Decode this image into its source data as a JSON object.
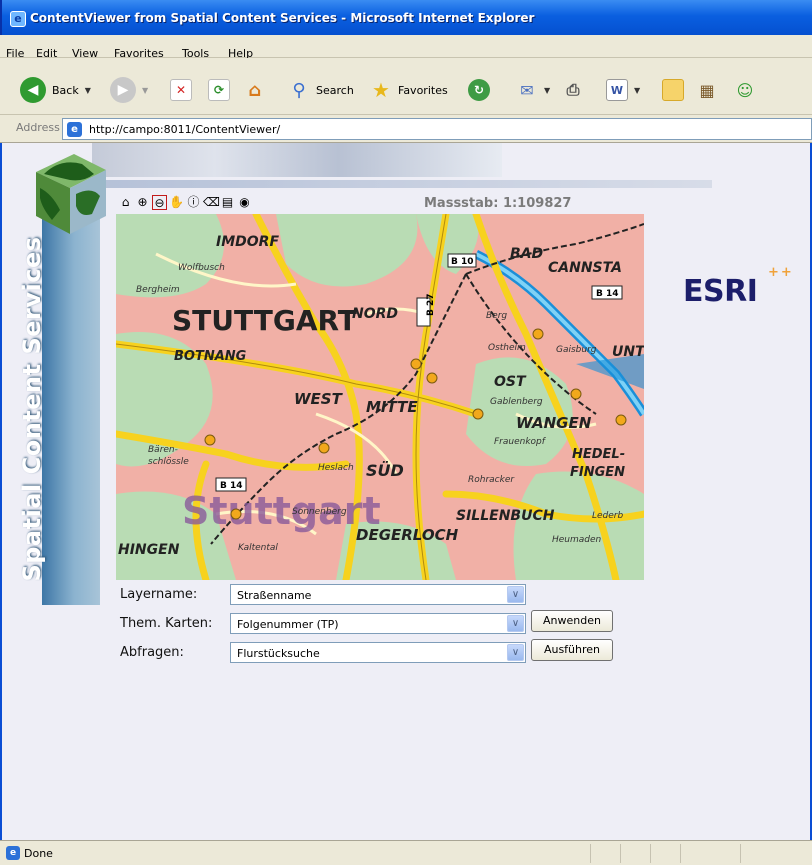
{
  "window": {
    "title": "ContentViewer from Spatial Content Services - Microsoft Internet Explorer"
  },
  "menu": [
    "File",
    "Edit",
    "View",
    "Favorites",
    "Tools",
    "Help"
  ],
  "toolbar": {
    "back_label": "Back",
    "search_label": "Search",
    "favorites_label": "Favorites"
  },
  "address": {
    "label": "Address",
    "url": "http://campo:8011/ContentViewer/"
  },
  "page": {
    "vertical_title": "Spatial Content Services",
    "scale_label": "Massstab: 1:109827",
    "logo": "ESRI",
    "logo_plus": "++"
  },
  "map": {
    "places": [
      {
        "name": "STUTTGART",
        "kind": "city"
      },
      {
        "name": "NORD",
        "kind": "district"
      },
      {
        "name": "WEST",
        "kind": "district"
      },
      {
        "name": "MITTE",
        "kind": "district"
      },
      {
        "name": "OST",
        "kind": "district"
      },
      {
        "name": "SÜD",
        "kind": "district"
      },
      {
        "name": "BOTNANG",
        "kind": "district"
      },
      {
        "name": "IMDORF",
        "kind": "district"
      },
      {
        "name": "WANGEN",
        "kind": "district"
      },
      {
        "name": "HEDEL-",
        "kind": "district"
      },
      {
        "name": "FINGEN",
        "kind": "district"
      },
      {
        "name": "DEGERLOCH",
        "kind": "district"
      },
      {
        "name": "SILLENBUCH",
        "kind": "district"
      },
      {
        "name": "BAD",
        "kind": "district"
      },
      {
        "name": "CANNSTA",
        "kind": "district"
      },
      {
        "name": "UNT",
        "kind": "district"
      },
      {
        "name": "HINGEN",
        "kind": "district"
      },
      {
        "name": "Stuttgart",
        "kind": "overlay"
      }
    ],
    "minor_labels": [
      "Gaisburg",
      "Gablenberg",
      "Frauenkopf",
      "Rohracker",
      "Heslach",
      "Sonnenberg",
      "Kaltental",
      "Bären-",
      "schlössle",
      "Wolfbusch",
      "Bergheim",
      "Berg",
      "Ostheim",
      "Heumaden",
      "Lederb"
    ],
    "road_signs": [
      "B 10",
      "B 27",
      "B 14",
      "B 14"
    ]
  },
  "form": {
    "layername": {
      "label": "Layername:",
      "value": "Straßenname"
    },
    "themkarten": {
      "label": "Them. Karten:",
      "value": "Folgenummer (TP)",
      "button": "Anwenden"
    },
    "abfragen": {
      "label": "Abfragen:",
      "value": "Flurstücksuche",
      "button": "Ausführen"
    }
  },
  "status": {
    "text": "Done"
  },
  "colors": {
    "title_bar": "#0a5fe0",
    "esri": "#1c1e6a",
    "banner": "#5c8db7",
    "map_urban": "#f1b0a6",
    "map_green": "#b9dcb4",
    "road_yellow": "#f7d21e"
  }
}
